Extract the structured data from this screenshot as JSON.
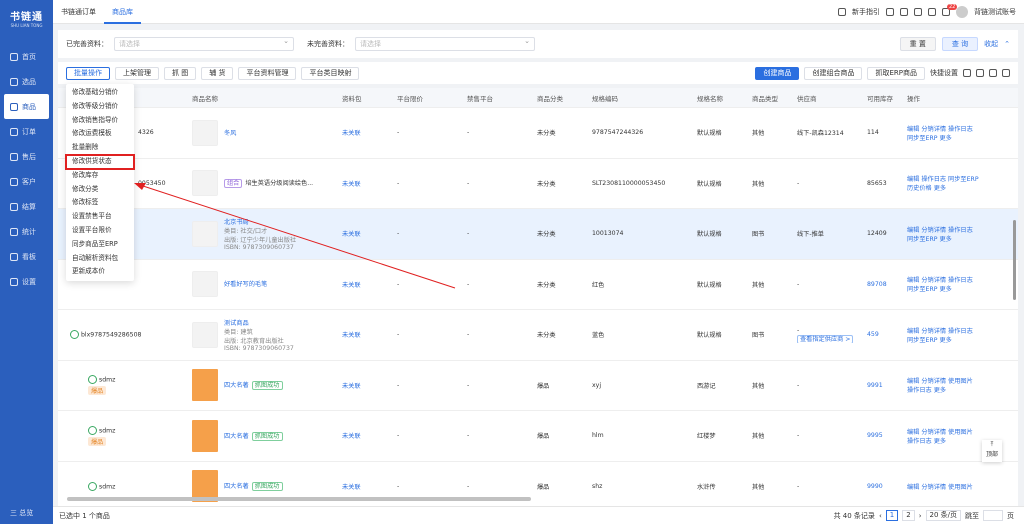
{
  "sidebar": {
    "logo": "书链通",
    "logo_sub": "SHU LIAN TONG",
    "items": [
      "首页",
      "选品",
      "商品",
      "订单",
      "售后",
      "客户",
      "结算",
      "统计",
      "看板",
      "设置"
    ],
    "collapse": "三 总览"
  },
  "topbar": {
    "tabs": [
      "书链通订单",
      "商品库"
    ],
    "guide": "新手指引",
    "badge": "22",
    "user": "背链测试账号"
  },
  "filters": {
    "complete_label": "已完善资料：",
    "incomplete_label": "未完善资料：",
    "placeholder": "请选择",
    "reset": "重 置",
    "query": "查 询",
    "collapse": "收起"
  },
  "toolbar": {
    "batch": "批量操作",
    "shelf": "上架管理",
    "grab": "抓 图",
    "match": "辅 货",
    "platform": "平台资料管理",
    "platform_map": "平台类目映射",
    "create": "创建商品",
    "create_combo": "创建组合商品",
    "erp": "抓取ERP商品",
    "quick": "快捷设置"
  },
  "headers": [
    "",
    "商品名称",
    "资料包",
    "平台限价",
    "禁售平台",
    "商品分类",
    "规格编码",
    "规格名称",
    "商品类型",
    "供应商",
    "可用库存",
    "操作"
  ],
  "dropdown": [
    "修改基础分销价",
    "修改等级分销价",
    "修改销售指导价",
    "修改运费模板",
    "批量删除",
    "修改供货状态",
    "修改库存",
    "修改分类",
    "修改标签",
    "设置禁售平台",
    "设置平台限价",
    "同步商品至ERP",
    "自动解析资料包",
    "更新成本价"
  ],
  "rows": [
    {
      "sku": "4326",
      "name": "冬风",
      "pkg": "未关联",
      "limit": "-",
      "ban": "-",
      "cat": "未分类",
      "code": "9787547244326",
      "spec": "默认规格",
      "type": "其他",
      "sup": "线下-凯森12314",
      "stock": "114",
      "op1": "编辑  分销详情  操作日志",
      "op2": "同步至ERP  更多"
    },
    {
      "sku": "0053450",
      "name": "培生英语分级阅读绘色...",
      "tag": "组合",
      "pkg": "未关联",
      "limit": "-",
      "ban": "-",
      "cat": "未分类",
      "code": "SLT2308110000053450",
      "spec": "默认规格",
      "type": "其他",
      "sup": "-",
      "stock": "85653",
      "op1": "编辑  操作日志  同步至ERP",
      "op2": "历史价格  更多"
    },
    {
      "sku": "",
      "name": "北京书局",
      "l2": "类目: 社交/口才",
      "l3": "出版: 辽宁少年儿童出版社",
      "l4": "ISBN: 9787309060737",
      "pkg": "未关联",
      "limit": "-",
      "ban": "-",
      "cat": "未分类",
      "code": "10013074",
      "spec": "默认规格",
      "type": "图书",
      "sup": "线下-推单",
      "stock": "12409",
      "op1": "编辑  分销详情  操作日志",
      "op2": "同步至ERP  更多"
    },
    {
      "sku": "",
      "name": "好看好写的毛笔",
      "pkg": "未关联",
      "limit": "-",
      "ban": "-",
      "cat": "未分类",
      "code": "红色",
      "spec": "默认规格",
      "type": "其他",
      "sup": "-",
      "stock": "89708",
      "op1": "编辑  分销详情  操作日志",
      "op2": "同步至ERP  更多"
    },
    {
      "sku": "blx9787549286508",
      "name": "测试商品",
      "l2": "类目: 建筑",
      "l3": "出版: 北京教育出版社",
      "l4": "ISBN: 9787309060737",
      "pkg": "未关联",
      "limit": "-",
      "ban": "-",
      "cat": "未分类",
      "code": "蓝色",
      "spec": "默认规格",
      "type": "图书",
      "sup": "查看指定供应商 >",
      "stock": "459",
      "op1": "编辑  分销详情  操作日志",
      "op2": "同步至ERP  更多"
    },
    {
      "sku": "sdmz",
      "badge": "爆品",
      "name": "四大名著",
      "tag2": "抓图成功",
      "pkg": "未关联",
      "limit": "-",
      "ban": "-",
      "cat": "爆品",
      "code": "xyj",
      "spec": "西游记",
      "type": "其他",
      "sup": "-",
      "stock": "9991",
      "op1": "编辑  分销详情  使用图片",
      "op2": "操作日志  更多"
    },
    {
      "sku": "sdmz",
      "badge": "爆品",
      "name": "四大名著",
      "tag2": "抓图成功",
      "pkg": "未关联",
      "limit": "-",
      "ban": "-",
      "cat": "爆品",
      "code": "hlm",
      "spec": "红楼梦",
      "type": "其他",
      "sup": "-",
      "stock": "9995",
      "op1": "编辑  分销详情  使用图片",
      "op2": "操作日志  更多"
    },
    {
      "sku": "sdmz",
      "badge": "",
      "name": "四大名著",
      "tag2": "抓图成功",
      "pkg": "未关联",
      "limit": "-",
      "ban": "-",
      "cat": "爆品",
      "code": "shz",
      "spec": "水浒传",
      "type": "其他",
      "sup": "-",
      "stock": "9990",
      "op1": "编辑  分销详情  使用图片",
      "op2": ""
    }
  ],
  "footer": {
    "selected": "已选中 1 个商品",
    "total": "共 40 条记录",
    "page1": "1",
    "page2": "2",
    "per": "20 条/页",
    "goto": "跳至",
    "page_unit": "页"
  },
  "topbtn": "顶部"
}
